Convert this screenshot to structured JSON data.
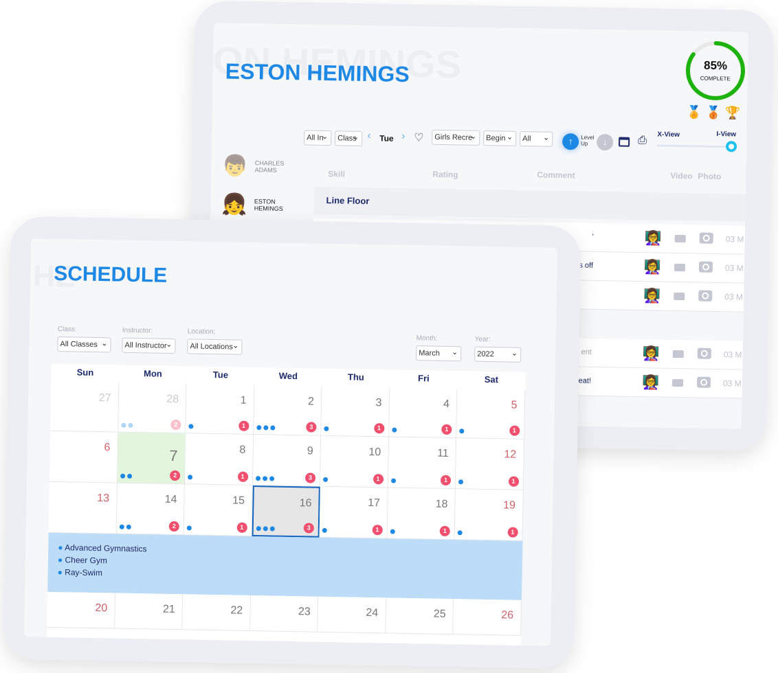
{
  "progress": {
    "percent": 85,
    "value_label": "85%",
    "label": "COMPLETE",
    "color": "#1db30c"
  },
  "athlete": {
    "title": "ESTON HEMINGS",
    "ghost": "ON HEMINGS"
  },
  "medals": [
    "gold-medal-icon",
    "bronze-medal-icon",
    "trophy-wings-icon"
  ],
  "students": [
    {
      "name1": "CHARLES",
      "name2": "ADAMS"
    },
    {
      "name1": "ESTON",
      "name2": "HEMINGS"
    }
  ],
  "toolbar": {
    "filter1": "All In",
    "filter2": "Class",
    "day": "Tue",
    "program": "Girls Recre",
    "level": "Begin",
    "all": "All",
    "level_up_1": "Level",
    "level_up_2": "Up",
    "xview": "X-View",
    "iview": "I-View",
    "slider_value": 1
  },
  "table": {
    "headers": [
      "Skill",
      "Rating",
      "Comment",
      "Video",
      "Photo"
    ],
    "section": "Line Floor",
    "rows": [
      {
        "comment": "'",
        "date": "03 M"
      },
      {
        "comment": "pays off",
        "date": "03 M"
      },
      {
        "comment": "",
        "date": "03 M"
      },
      {
        "comment": "ent",
        "date": "03 M"
      },
      {
        "comment": "great!",
        "date": "03 M"
      }
    ]
  },
  "schedule": {
    "title": "SCHEDULE",
    "ghost": "HE",
    "filters": {
      "class_label": "Class:",
      "class": "All Classes",
      "instructor_label": "Instructor:",
      "instructor": "All Instructor",
      "location_label": "Location:",
      "location": "All Locations",
      "month_label": "Month:",
      "month": "March",
      "year_label": "Year:",
      "year": "2022"
    },
    "days": [
      "Sun",
      "Mon",
      "Tue",
      "Wed",
      "Thu",
      "Fri",
      "Sat"
    ],
    "weeks": [
      [
        {
          "d": "27",
          "o": 1
        },
        {
          "d": "28",
          "o": 1,
          "dots": 2,
          "n": "2"
        },
        {
          "d": "1",
          "dots": 1,
          "n": "1"
        },
        {
          "d": "2",
          "dots": 3,
          "n": "3"
        },
        {
          "d": "3",
          "dots": 1,
          "n": "1"
        },
        {
          "d": "4",
          "dots": 1,
          "n": "1"
        },
        {
          "d": "5",
          "w": 1,
          "dots": 1,
          "n": "1"
        }
      ],
      [
        {
          "d": "6",
          "w": 1
        },
        {
          "d": "7",
          "today": 1,
          "dots": 2,
          "n": "2"
        },
        {
          "d": "8",
          "dots": 1,
          "n": "1"
        },
        {
          "d": "9",
          "dots": 3,
          "n": "3"
        },
        {
          "d": "10",
          "dots": 1,
          "n": "1"
        },
        {
          "d": "11",
          "dots": 1,
          "n": "1"
        },
        {
          "d": "12",
          "w": 1,
          "dots": 1,
          "n": "1"
        }
      ],
      [
        {
          "d": "13",
          "w": 1
        },
        {
          "d": "14",
          "dots": 2,
          "n": "2"
        },
        {
          "d": "15",
          "dots": 1,
          "n": "1"
        },
        {
          "d": "16",
          "selected": 1,
          "dots": 3,
          "n": "3"
        },
        {
          "d": "17",
          "dots": 1,
          "n": "1"
        },
        {
          "d": "18",
          "dots": 1,
          "n": "1"
        },
        {
          "d": "19",
          "w": 1,
          "dots": 1,
          "n": "1"
        }
      ],
      [
        {
          "d": "20",
          "w": 1
        },
        {
          "d": "21"
        },
        {
          "d": "22"
        },
        {
          "d": "23"
        },
        {
          "d": "24"
        },
        {
          "d": "25"
        },
        {
          "d": "26",
          "w": 1
        }
      ]
    ],
    "events": [
      "Advanced Gymnastics",
      "Cheer Gym",
      "Ray-Swim"
    ]
  }
}
